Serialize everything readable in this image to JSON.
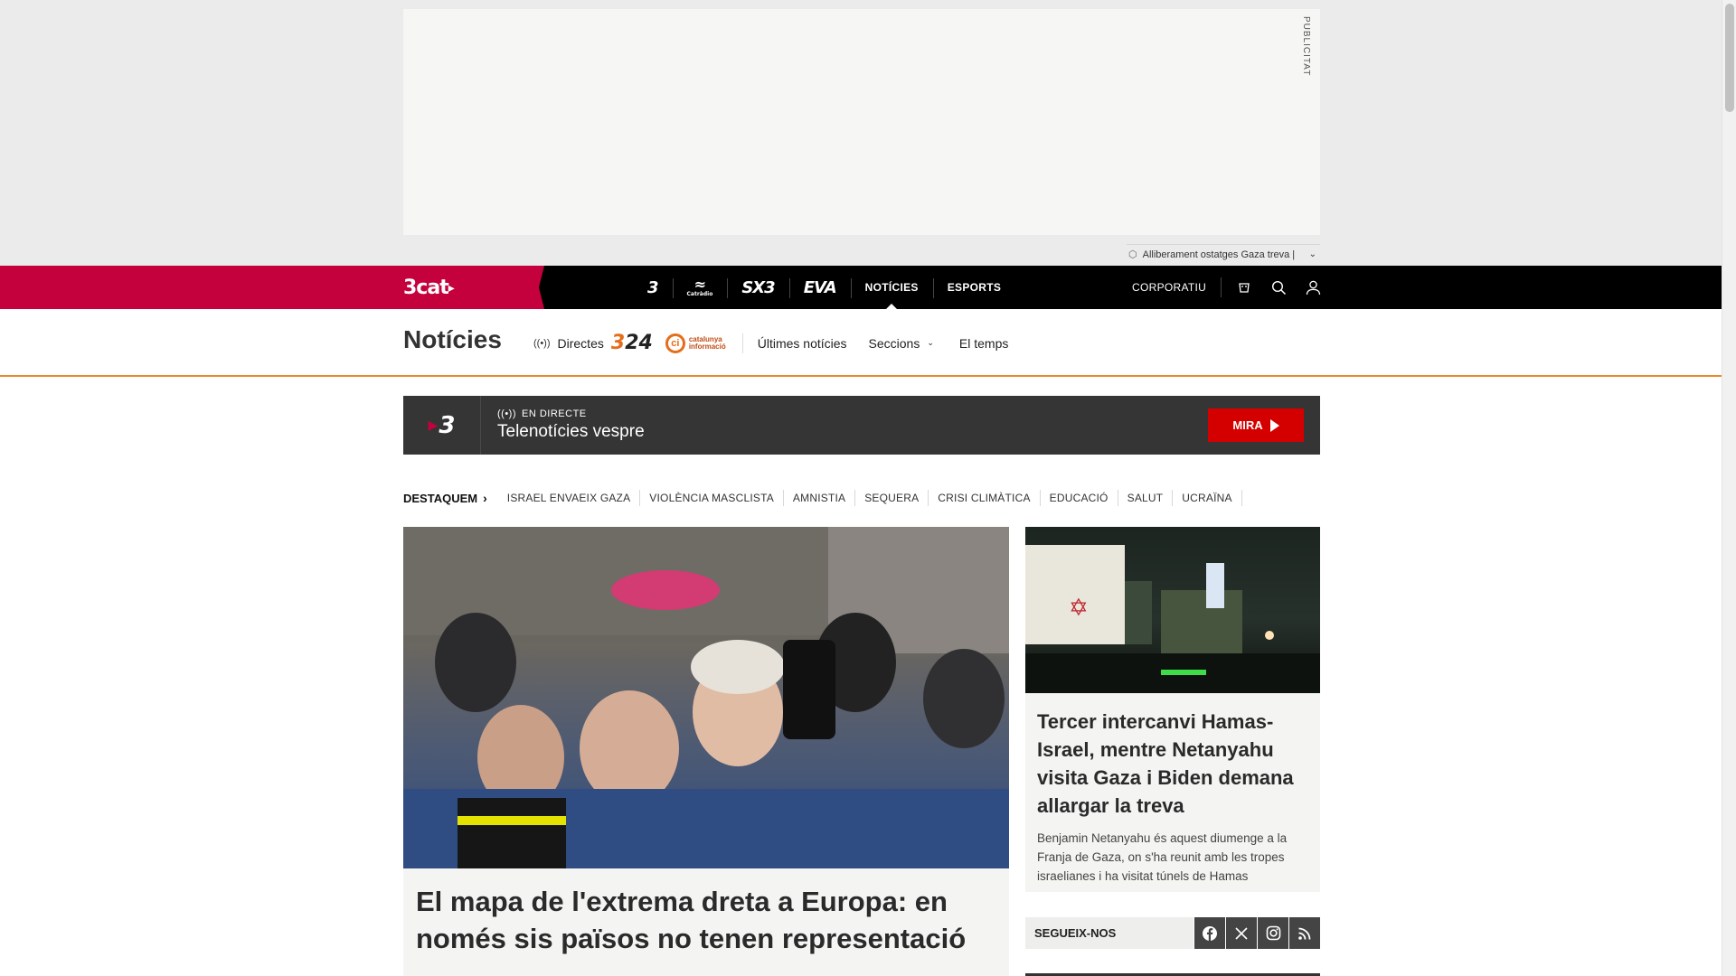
{
  "ad": {
    "label": "PUBLICITAT",
    "ticker_text": "Alliberament ostatges Gaza treva |"
  },
  "topnav": {
    "brand": "3cat",
    "channels": [
      {
        "label": "3",
        "kind": "logo",
        "name": "channel-tv3"
      },
      {
        "label": "Catràdio",
        "kind": "catradio",
        "name": "channel-catradio"
      },
      {
        "label": "SX3",
        "kind": "logo",
        "name": "channel-sx3"
      },
      {
        "label": "EVA",
        "kind": "logo",
        "name": "channel-eva"
      },
      {
        "label": "NOTÍCIES",
        "kind": "text",
        "name": "channel-noticies",
        "active": true
      },
      {
        "label": "ESPORTS",
        "kind": "text",
        "name": "channel-esports"
      }
    ],
    "corporatiu": "CORPORATIU",
    "icons": [
      "cart-icon",
      "search-icon",
      "user-icon"
    ]
  },
  "sectionbar": {
    "title": "Notícies",
    "directes": "Directes",
    "logo_324": "324",
    "catinfo_line1": "catalunya",
    "catinfo_line2": "informació",
    "ultimes": "Últimes notícies",
    "seccions": "Seccions",
    "temps": "El temps"
  },
  "live": {
    "status": "EN DIRECTE",
    "programme": "Telenotícies vespre",
    "button": "MIRA",
    "channel_logo": "3"
  },
  "destaquem": {
    "label": "DESTAQUEM",
    "tags": [
      "ISRAEL ENVAEIX GAZA",
      "VIOLÈNCIA MASCLISTA",
      "AMNISTIA",
      "SEQUERA",
      "CRISI CLIMÀTICA",
      "EDUCACIÓ",
      "SALUT",
      "UCRAÏNA"
    ]
  },
  "main_story": {
    "headline": "El mapa de l'extrema dreta a Europa: en només sis països no tenen representació"
  },
  "side_story": {
    "headline": "Tercer intercanvi Hamas-Israel, mentre Netanyahu visita Gaza i Biden demana allargar la treva",
    "summary": "Benjamin Netanyahu és aquest diumenge a la Franja de Gaza, on s'ha reunit amb les tropes israelianes i ha visitat túnels de Hamas"
  },
  "follow": {
    "label": "SEGUEIX-NOS",
    "networks": [
      "facebook-icon",
      "x-icon",
      "instagram-icon",
      "rss-icon"
    ]
  },
  "colors": {
    "brand": "#c4003d",
    "accent_orange": "#e98a2c",
    "live_bg": "#353535",
    "mira_red": "#d40000"
  }
}
